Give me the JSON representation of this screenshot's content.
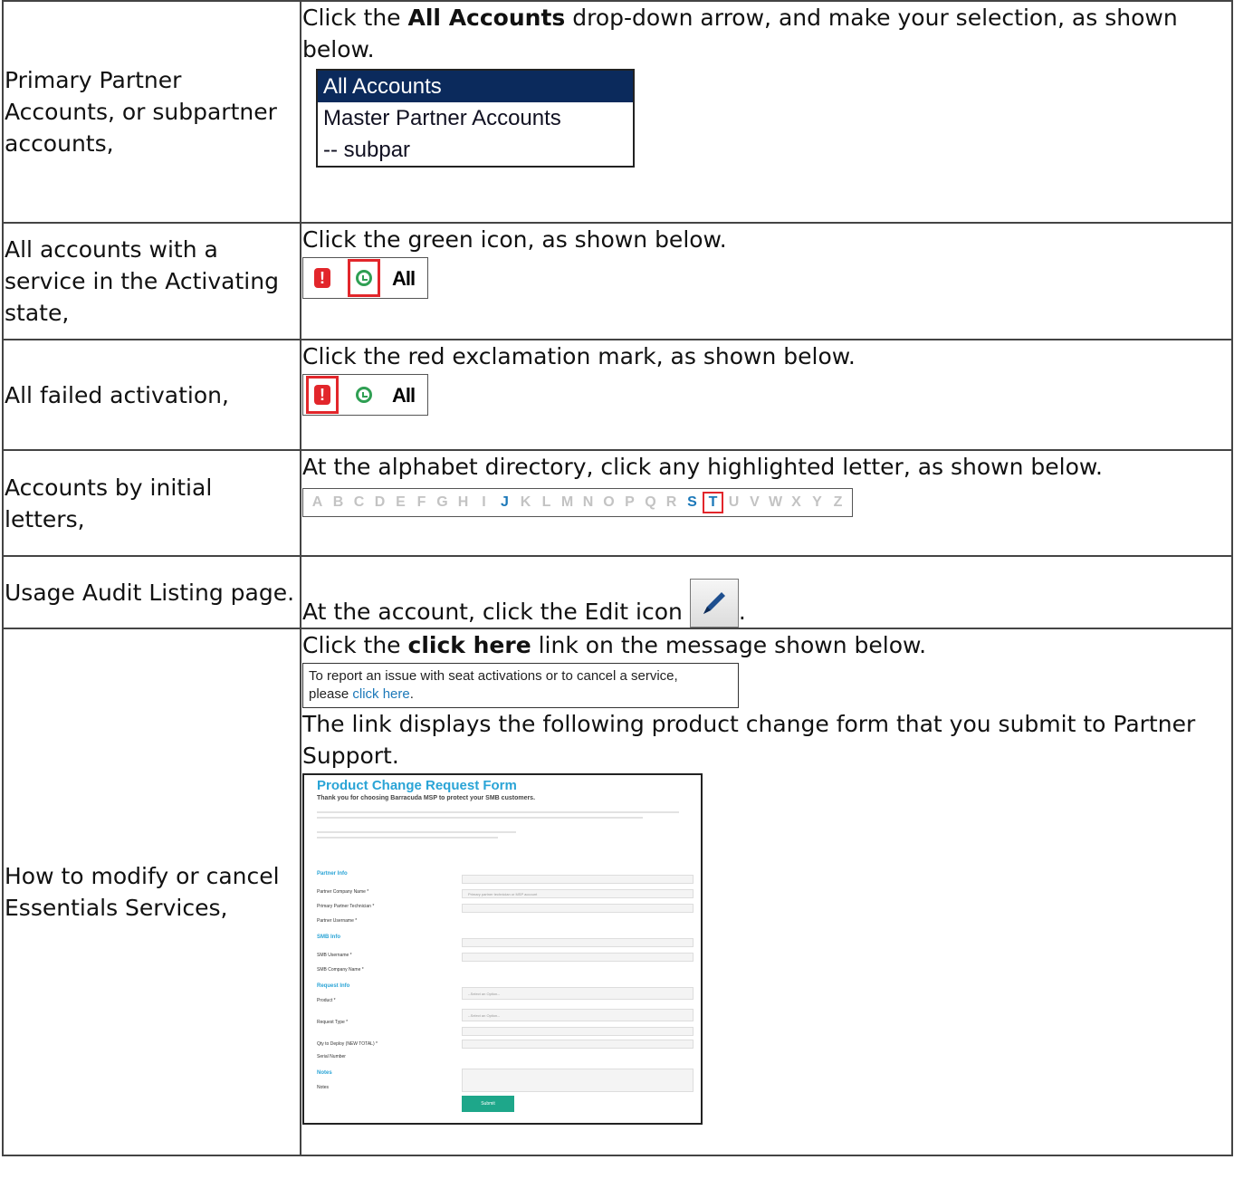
{
  "rows": {
    "primary": {
      "label": "Primary Partner Accounts, or subpartner accounts,",
      "text_pre": "Click the ",
      "text_bold": "All Accounts",
      "text_post": " drop-down arrow, and make your selection, as shown below.",
      "dropdown_options": [
        "All Accounts",
        "Master Partner Accounts",
        "-- subpar"
      ]
    },
    "activating": {
      "label": "All accounts with a service in the Activating state,",
      "text": "Click the green icon, as shown below.",
      "all_label": "All",
      "exclaim_glyph": "!"
    },
    "failed": {
      "label": "All failed activation,",
      "text": "Click the red exclamation mark, as shown below.",
      "all_label": "All",
      "exclaim_glyph": "!"
    },
    "initials": {
      "label": "Accounts by initial letters,",
      "text": "At the alphabet directory, click any highlighted letter, as shown below.",
      "letters": [
        "A",
        "B",
        "C",
        "D",
        "E",
        "F",
        "G",
        "H",
        "I",
        "J",
        "K",
        "L",
        "M",
        "N",
        "O",
        "P",
        "Q",
        "R",
        "S",
        "T",
        "U",
        "V",
        "W",
        "X",
        "Y",
        "Z"
      ],
      "highlighted": [
        "J",
        "S",
        "T"
      ],
      "boxed": "T"
    },
    "usage": {
      "label": "Usage Audit Listing page.",
      "text": "At the account, click the Edit icon",
      "suffix": "."
    },
    "essentials": {
      "label": "How to modify or cancel Essentials Services,",
      "text_pre": "Click the ",
      "text_bold": "click here",
      "text_post": " link on the message shown below.",
      "message_line1": "To report an issue with seat activations or to cancel a service,",
      "message_line2_pre": "please ",
      "message_link": "click here",
      "message_line2_post": ".",
      "follow_text": "The link displays the following product change form that you submit to Partner Support.",
      "form": {
        "title": "Product Change Request Form",
        "subtitle": "Thank you for choosing Barracuda MSP to protect your SMB customers.",
        "sections": [
          "Partner Info",
          "SMB Info",
          "Request Info",
          "Notes"
        ],
        "fields": [
          "Partner Company Name *",
          "Primary Partner Technician *",
          "Partner Username *",
          "SMB Username *",
          "SMB Company Name *",
          "Product *",
          "Request Type *",
          "Qty to Deploy (NEW TOTAL) *",
          "Serial Number",
          "Notes"
        ],
        "select_placeholder": "--Select an Option--",
        "tech_placeholder": "Primary partner technician or MSP account",
        "submit": "Submit"
      }
    }
  },
  "colors": {
    "alert_red": "#e2262b",
    "active_green": "#2f9f53",
    "letter_blue": "#1b78b9",
    "dropdown_selected": "#0b2a5c",
    "form_accent": "#2aa4d6",
    "submit_green": "#1ea78a"
  }
}
